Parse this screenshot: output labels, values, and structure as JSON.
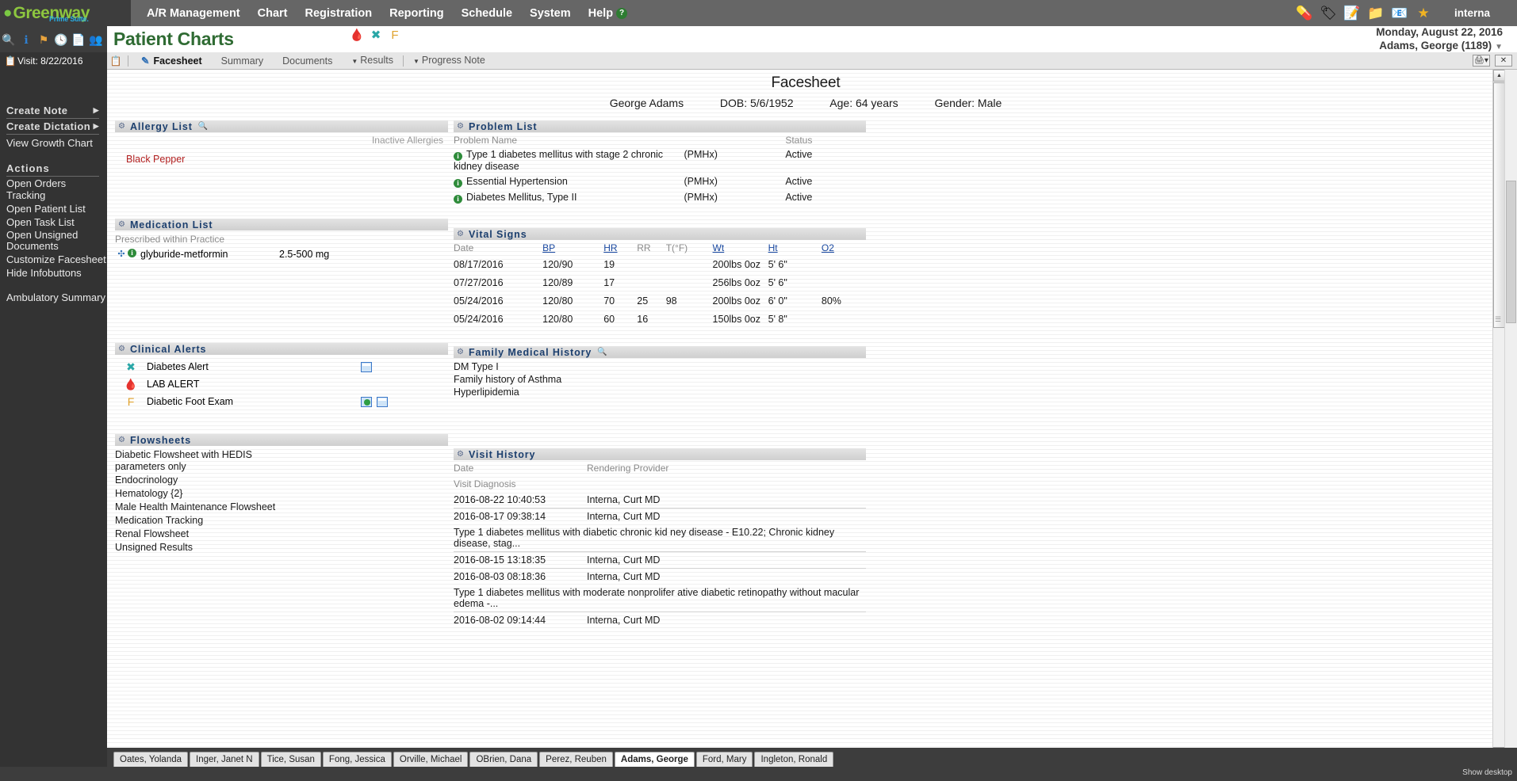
{
  "topbar": {
    "brand": "Greenway",
    "brand_sub": "Prime Suite.",
    "menu": [
      "A/R Management",
      "Chart",
      "Registration",
      "Reporting",
      "Schedule",
      "System",
      "Help"
    ],
    "help_badge": "?",
    "icons": [
      "pill-icon",
      "prescription-icon",
      "notepad-icon",
      "folder-icon",
      "mail-icon",
      "star-icon"
    ],
    "user": "interna"
  },
  "icon_strip": [
    "search-patient-icon",
    "info-icon",
    "flag-icon",
    "patient-clock-icon",
    "document-icon",
    "group-icon"
  ],
  "header": {
    "title": "Patient Charts",
    "icons": [
      "blood-icon",
      "diabetes-alert-icon",
      "foot-exam-icon"
    ],
    "date": "Monday, August 22, 2016",
    "patient": "Adams, George (1189)"
  },
  "tabstrip": {
    "tabs": [
      {
        "label": "Facesheet",
        "active": true,
        "dropdown": false
      },
      {
        "label": "Summary",
        "active": false,
        "dropdown": false
      },
      {
        "label": "Documents",
        "active": false,
        "dropdown": false
      },
      {
        "label": "Results",
        "active": false,
        "dropdown": true
      },
      {
        "label": "Progress Note",
        "active": false,
        "dropdown": true
      }
    ]
  },
  "sidebar": {
    "visit_label": "Visit: 8/22/2016",
    "create_note": "Create Note",
    "create_dictation": "Create Dictation",
    "view_growth_chart": "View Growth Chart",
    "actions_header": "Actions",
    "actions": [
      "Open Orders Tracking",
      "Open Patient List",
      "Open Task List",
      "Open Unsigned Documents",
      "Customize Facesheet",
      "Hide Infobuttons"
    ],
    "ambulatory_summary": "Ambulatory Summary"
  },
  "facesheet": {
    "title": "Facesheet",
    "patient_name": "George Adams",
    "dob": "DOB: 5/6/1952",
    "age": "Age: 64 years",
    "gender": "Gender: Male"
  },
  "allergy_list": {
    "title": "Allergy List",
    "inactive_label": "Inactive Allergies",
    "items": [
      "Black Pepper"
    ]
  },
  "problem_list": {
    "title": "Problem List",
    "columns": [
      "Problem Name",
      "",
      "Status"
    ],
    "rows": [
      {
        "name": "Type 1 diabetes mellitus with stage 2 chronic kidney disease",
        "source": "(PMHx)",
        "status": "Active"
      },
      {
        "name": "Essential Hypertension",
        "source": "(PMHx)",
        "status": "Active"
      },
      {
        "name": "Diabetes Mellitus, Type II",
        "source": "(PMHx)",
        "status": "Active"
      }
    ]
  },
  "medication_list": {
    "title": "Medication List",
    "subtitle": "Prescribed within Practice",
    "rows": [
      {
        "name": "glyburide-metformin",
        "dose": "2.5-500 mg"
      }
    ]
  },
  "vital_signs": {
    "title": "Vital Signs",
    "columns": [
      "Date",
      "BP",
      "HR",
      "RR",
      "T(°F)",
      "Wt",
      "Ht",
      "O2"
    ],
    "rows": [
      {
        "date": "08/17/2016",
        "bp": "120/90",
        "hr": "19",
        "rr": "",
        "t": "",
        "wt": "200lbs 0oz",
        "ht": "5' 6\"",
        "o2": ""
      },
      {
        "date": "07/27/2016",
        "bp": "120/89",
        "hr": "17",
        "rr": "",
        "t": "",
        "wt": "256lbs 0oz",
        "ht": "5' 6\"",
        "o2": ""
      },
      {
        "date": "05/24/2016",
        "bp": "120/80",
        "hr": "70",
        "rr": "25",
        "t": "98",
        "wt": "200lbs 0oz",
        "ht": "6' 0\"",
        "o2": "80%"
      },
      {
        "date": "05/24/2016",
        "bp": "120/80",
        "hr": "60",
        "rr": "16",
        "t": "",
        "wt": "150lbs 0oz",
        "ht": "5' 8\"",
        "o2": ""
      }
    ]
  },
  "clinical_alerts": {
    "title": "Clinical Alerts",
    "rows": [
      {
        "icon": "diabetes-alert-icon",
        "label": "Diabetes Alert",
        "buttons": [
          "window-icon"
        ]
      },
      {
        "icon": "blood-lab-icon",
        "label": "LAB ALERT",
        "buttons": []
      },
      {
        "icon": "foot-exam-icon",
        "label": "Diabetic Foot Exam",
        "buttons": [
          "globe-icon",
          "window-icon"
        ]
      }
    ]
  },
  "family_medical_history": {
    "title": "Family Medical History",
    "items": [
      "DM Type I",
      "Family history of Asthma",
      "Hyperlipidemia"
    ]
  },
  "flowsheets": {
    "title": "Flowsheets",
    "items": [
      "Diabetic Flowsheet with HEDIS parameters only",
      "Endocrinology",
      "Hematology {2}",
      "Male Health Maintenance Flowsheet",
      "Medication Tracking",
      "Renal Flowsheet",
      "Unsigned Results"
    ]
  },
  "visit_history": {
    "title": "Visit History",
    "columns": [
      "Date",
      "Rendering Provider"
    ],
    "subcolumn": "Visit Diagnosis",
    "rows": [
      {
        "date": "2016-08-22 10:40:53",
        "provider": "Interna, Curt MD",
        "diagnosis": ""
      },
      {
        "date": "2016-08-17 09:38:14",
        "provider": "Interna, Curt MD",
        "diagnosis": "Type 1 diabetes mellitus with diabetic chronic kid ney disease - E10.22; Chronic kidney disease, stag..."
      },
      {
        "date": "2016-08-15 13:18:35",
        "provider": "Interna, Curt MD",
        "diagnosis": ""
      },
      {
        "date": "2016-08-03 08:18:36",
        "provider": "Interna, Curt MD",
        "diagnosis": "Type 1 diabetes mellitus with moderate nonprolifer ative diabetic retinopathy without macular edema -..."
      },
      {
        "date": "2016-08-02 09:14:44",
        "provider": "Interna, Curt MD",
        "diagnosis": ""
      }
    ]
  },
  "patient_tabs": [
    {
      "label": "Oates, Yolanda",
      "active": false
    },
    {
      "label": "Inger, Janet N",
      "active": false
    },
    {
      "label": "Tice, Susan",
      "active": false
    },
    {
      "label": "Fong, Jessica",
      "active": false
    },
    {
      "label": "Orville, Michael",
      "active": false
    },
    {
      "label": "OBrien, Dana",
      "active": false
    },
    {
      "label": "Perez, Reuben",
      "active": false
    },
    {
      "label": "Adams, George",
      "active": true
    },
    {
      "label": "Ford, Mary",
      "active": false
    },
    {
      "label": "Ingleton, Ronald",
      "active": false
    }
  ],
  "taskbar": {
    "show_desktop": "Show desktop"
  }
}
